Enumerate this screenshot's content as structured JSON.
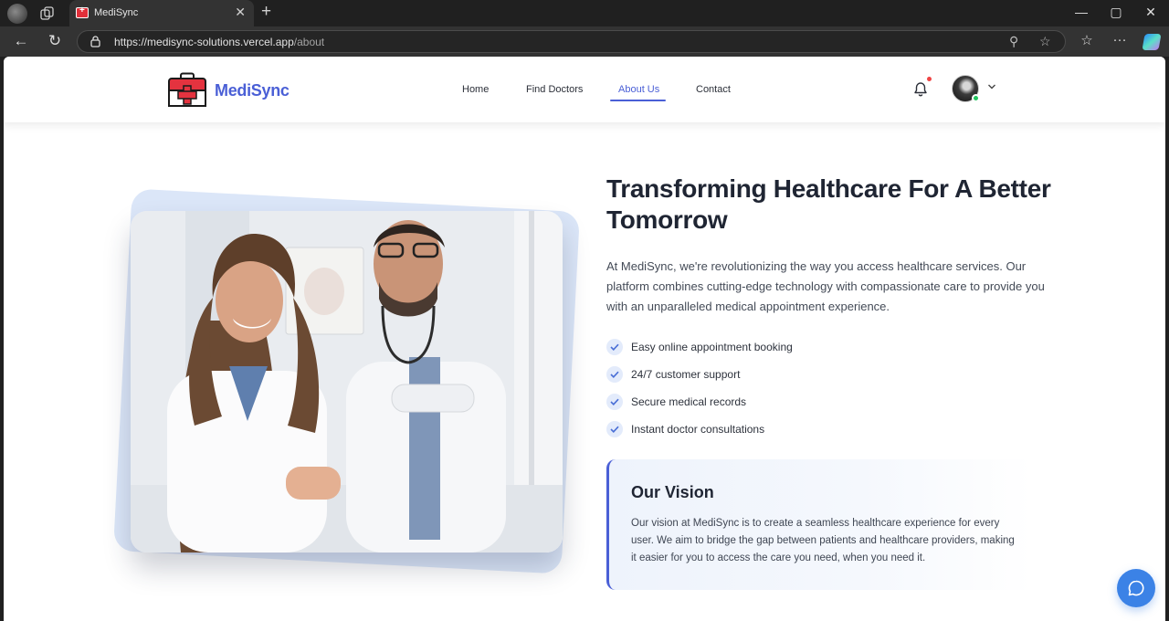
{
  "browser": {
    "tab_title": "MediSync",
    "url_host": "https://medisync-solutions.vercel.app",
    "url_path": "/about"
  },
  "header": {
    "brand": "MediSync",
    "nav": [
      {
        "label": "Home",
        "active": false
      },
      {
        "label": "Find Doctors",
        "active": false
      },
      {
        "label": "About Us",
        "active": true
      },
      {
        "label": "Contact",
        "active": false
      }
    ]
  },
  "hero": {
    "title": "Transforming Healthcare For A Better Tomorrow",
    "description": "At MediSync, we're revolutionizing the way you access healthcare services. Our platform combines cutting-edge technology with compassionate care to provide you with an unparalleled medical appointment experience.",
    "features": [
      "Easy online appointment booking",
      "24/7 customer support",
      "Secure medical records",
      "Instant doctor consultations"
    ]
  },
  "vision": {
    "title": "Our Vision",
    "text": "Our vision at MediSync is to create a seamless healthcare experience for every user. We aim to bridge the gap between patients and healthcare providers, making it easier for you to access the care you need, when you need it."
  },
  "colors": {
    "brand": "#4a5fd6",
    "chat": "#3b82e6",
    "online": "#22c55e",
    "notification": "#ef4444"
  }
}
